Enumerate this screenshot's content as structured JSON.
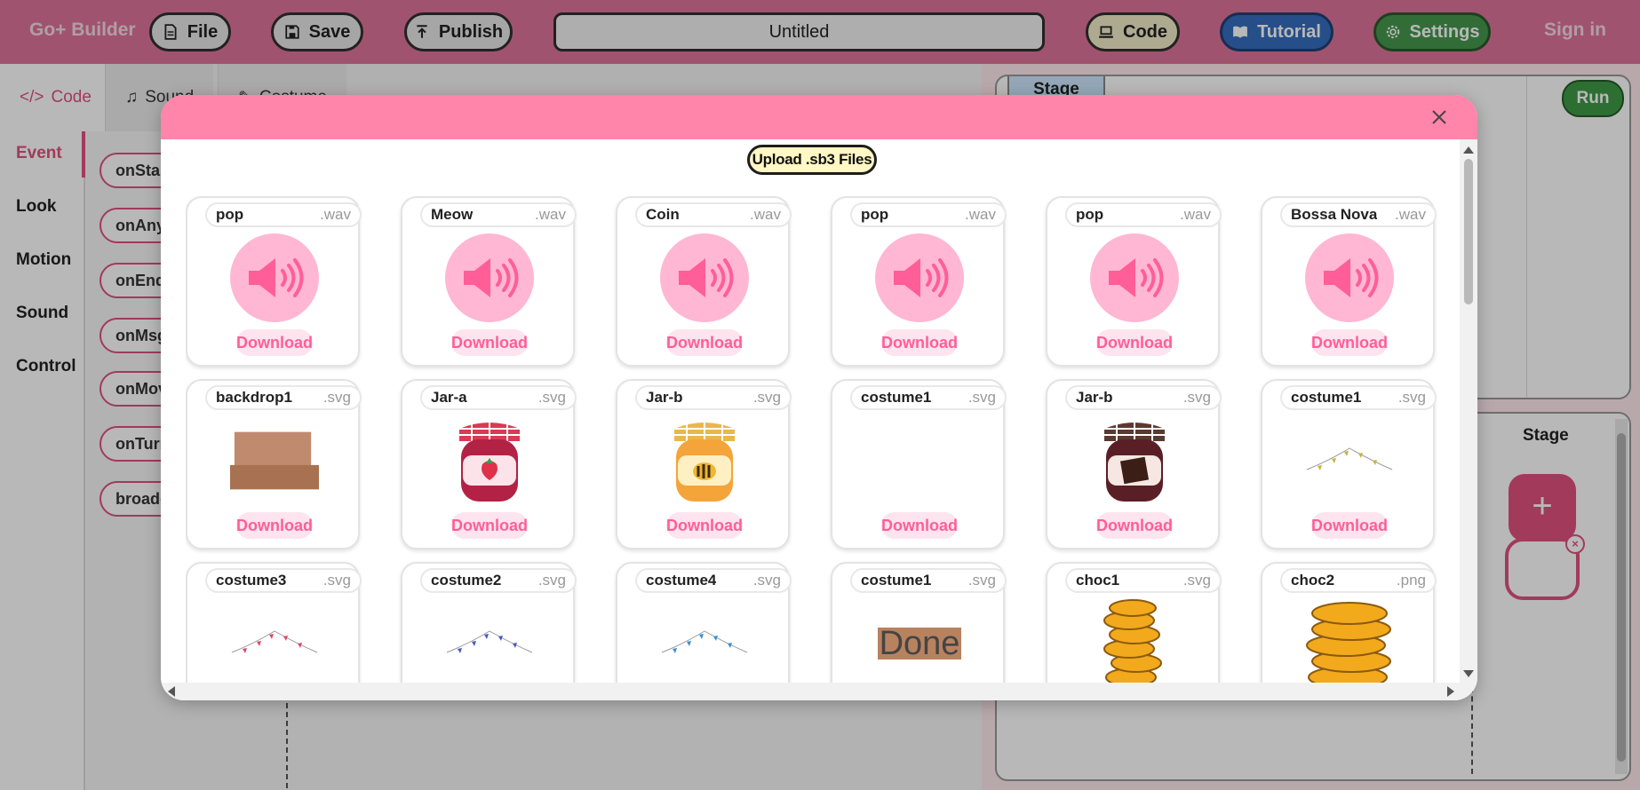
{
  "navbar": {
    "brand": "Go+ Builder",
    "file_label": "File",
    "save_label": "Save",
    "publish_label": "Publish",
    "project_title": "Untitled",
    "code_label": "Code",
    "tutorial_label": "Tutorial",
    "settings_label": "Settings",
    "sign_in_label": "Sign in"
  },
  "workspace": {
    "tabs": [
      "Code",
      "Sound",
      "Costume"
    ],
    "categories": [
      "Event",
      "Look",
      "Motion",
      "Sound",
      "Control"
    ],
    "blocks": [
      "onStart",
      "onAnyKey",
      "onEnd",
      "onMsg",
      "onMoving",
      "onTurning",
      "broadcast"
    ],
    "stage_tab": "Stage",
    "run_label": "Run",
    "sprites_label": "Stage",
    "add_label": "+"
  },
  "modal": {
    "upload_label": "Upload .sb3 Files",
    "download_label": "Download",
    "assets": [
      {
        "name": "pop",
        "ext": ".wav",
        "kind": "sound"
      },
      {
        "name": "Meow",
        "ext": ".wav",
        "kind": "sound"
      },
      {
        "name": "Coin",
        "ext": ".wav",
        "kind": "sound"
      },
      {
        "name": "pop",
        "ext": ".wav",
        "kind": "sound"
      },
      {
        "name": "pop",
        "ext": ".wav",
        "kind": "sound"
      },
      {
        "name": "Bossa Nova",
        "ext": ".wav",
        "kind": "sound"
      },
      {
        "name": "backdrop1",
        "ext": ".svg",
        "kind": "backdrop"
      },
      {
        "name": "Jar-a",
        "ext": ".svg",
        "kind": "jar-strawberry"
      },
      {
        "name": "Jar-b",
        "ext": ".svg",
        "kind": "jar-honey"
      },
      {
        "name": "costume1",
        "ext": ".svg",
        "kind": "empty"
      },
      {
        "name": "Jar-b",
        "ext": ".svg",
        "kind": "jar-chocolate"
      },
      {
        "name": "costume1",
        "ext": ".svg",
        "kind": "bunting-yellow"
      },
      {
        "name": "costume3",
        "ext": ".svg",
        "kind": "bunting-red"
      },
      {
        "name": "costume2",
        "ext": ".svg",
        "kind": "bunting-blue"
      },
      {
        "name": "costume4",
        "ext": ".svg",
        "kind": "bunting-cyan"
      },
      {
        "name": "costume1",
        "ext": ".svg",
        "kind": "done"
      },
      {
        "name": "choc1",
        "ext": ".svg",
        "kind": "coins-small"
      },
      {
        "name": "choc2",
        "ext": ".png",
        "kind": "coins-large"
      }
    ],
    "done_text": "Done"
  },
  "colors": {
    "accent": "#ff85aa",
    "brand_pink": "#e0517f",
    "download_text": "#ff5e97",
    "sound_circle": "#ffb7d3",
    "upload_bg": "#fff7c4"
  }
}
